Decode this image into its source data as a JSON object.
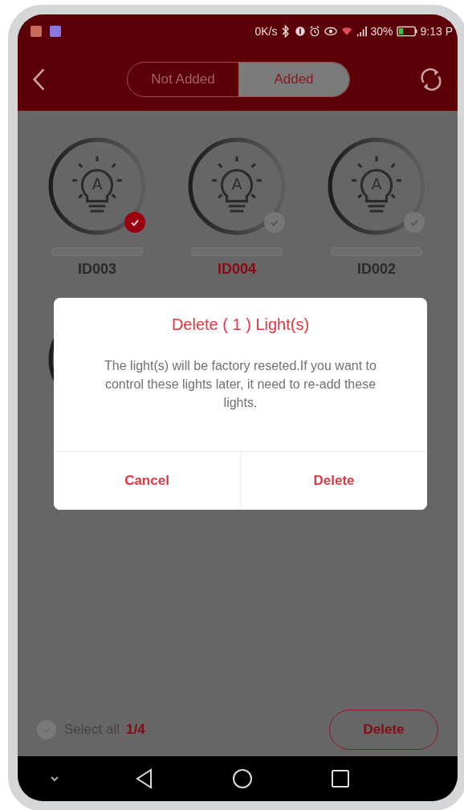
{
  "status_bar": {
    "speed": "0K/s",
    "battery": "30%",
    "time": "9:13 P"
  },
  "header": {
    "tabs": [
      {
        "label": "Not Added",
        "selected": false
      },
      {
        "label": "Added",
        "selected": true
      }
    ]
  },
  "lights": [
    {
      "kind": "full",
      "icon_letter": "A",
      "label": "ID003",
      "selected": true,
      "highlighted": false
    },
    {
      "kind": "full",
      "icon_letter": "A",
      "label": "ID004",
      "selected": false,
      "highlighted": true
    },
    {
      "kind": "full",
      "icon_letter": "A",
      "label": "ID002",
      "selected": false,
      "highlighted": false
    },
    {
      "kind": "covered"
    }
  ],
  "dialog": {
    "title": "Delete ( 1 ) Light(s)",
    "message": "The light(s) will be factory reseted.If you want to control these lights later, it need to re-add these lights.",
    "buttons": [
      "Cancel",
      "Delete"
    ]
  },
  "footer": {
    "select_all": {
      "label": "Select all",
      "checked": false
    },
    "count": "1/4",
    "delete_button": "Delete"
  }
}
